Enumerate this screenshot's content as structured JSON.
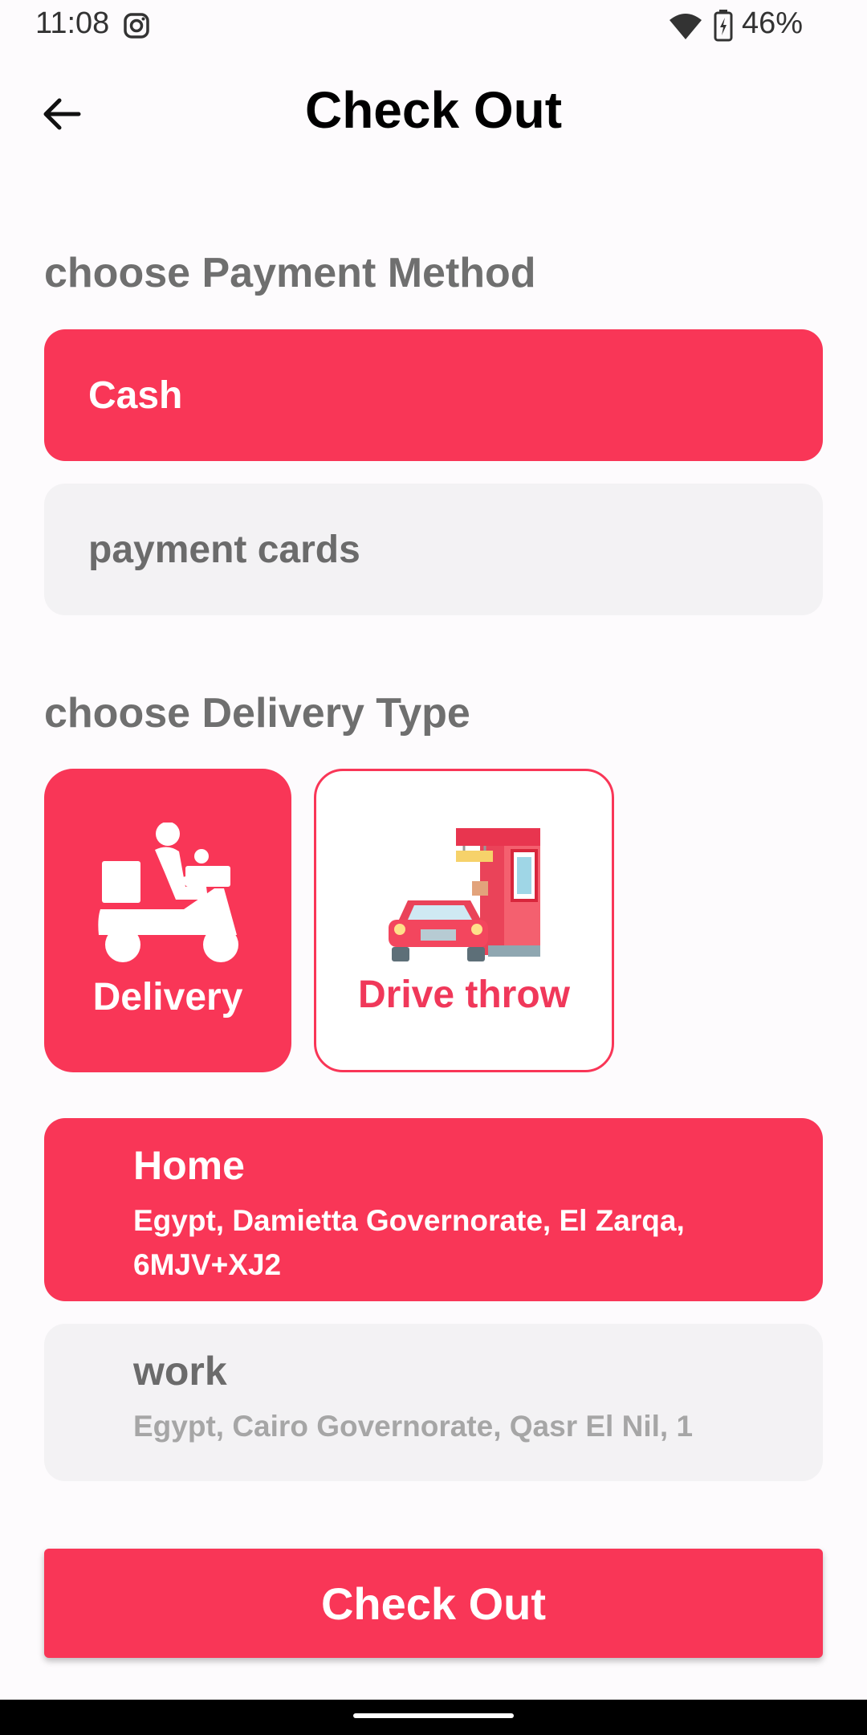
{
  "status_bar": {
    "time": "11:08",
    "battery": "46%"
  },
  "header": {
    "title": "Check Out"
  },
  "payment": {
    "section_label": "choose Payment Method",
    "options": [
      {
        "label": "Cash",
        "selected": true
      },
      {
        "label": "payment cards",
        "selected": false
      }
    ]
  },
  "delivery": {
    "section_label": "choose Delivery Type",
    "options": [
      {
        "label": "Delivery",
        "icon": "scooter-icon",
        "selected": true
      },
      {
        "label": "Drive throw",
        "icon": "drive-through-icon",
        "selected": false
      }
    ]
  },
  "addresses": [
    {
      "name": "Home",
      "address": "Egypt, Damietta Governorate, El Zarqa, 6MJV+XJ2",
      "selected": true
    },
    {
      "name": "work",
      "address": "Egypt, Cairo Governorate, Qasr El Nil, 1",
      "selected": false
    }
  ],
  "checkout_button": {
    "label": "Check Out"
  },
  "colors": {
    "accent": "#f93657",
    "unselected_bg": "#f3f2f4",
    "label_gray": "#6f6f6f"
  }
}
